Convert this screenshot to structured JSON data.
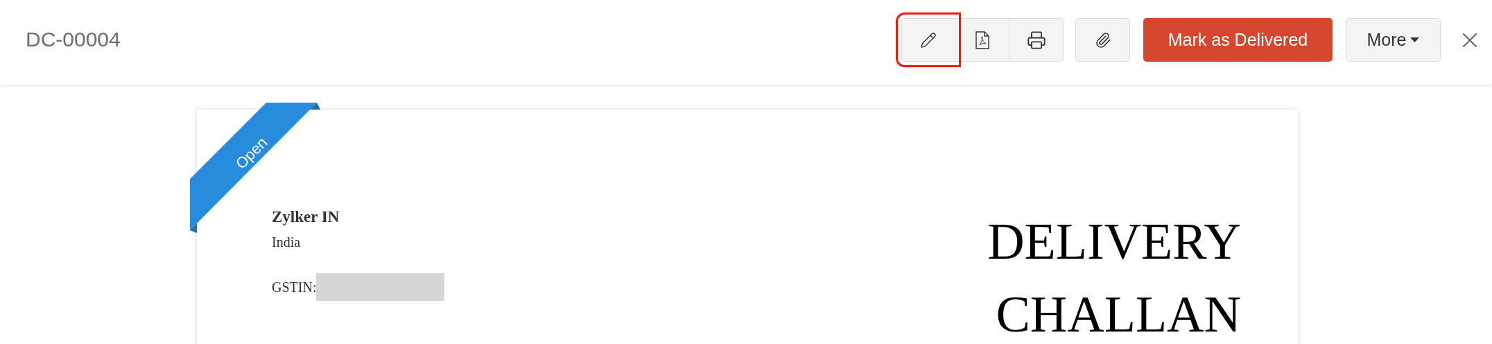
{
  "header": {
    "title": "DC-00004",
    "tools": [
      {
        "kind": "edit",
        "highlighted": true
      },
      {
        "kind": "pdf",
        "highlighted": false
      },
      {
        "kind": "print",
        "highlighted": false
      }
    ],
    "attach": {
      "kind": "attach"
    },
    "primary_button": "Mark as Delivered",
    "more_button": "More"
  },
  "document": {
    "status_ribbon": "Open",
    "company": "Zylker IN",
    "country": "India",
    "gstin_label": "GSTIN:",
    "title_lines": [
      "DELIVERY",
      "CHALLAN"
    ]
  }
}
